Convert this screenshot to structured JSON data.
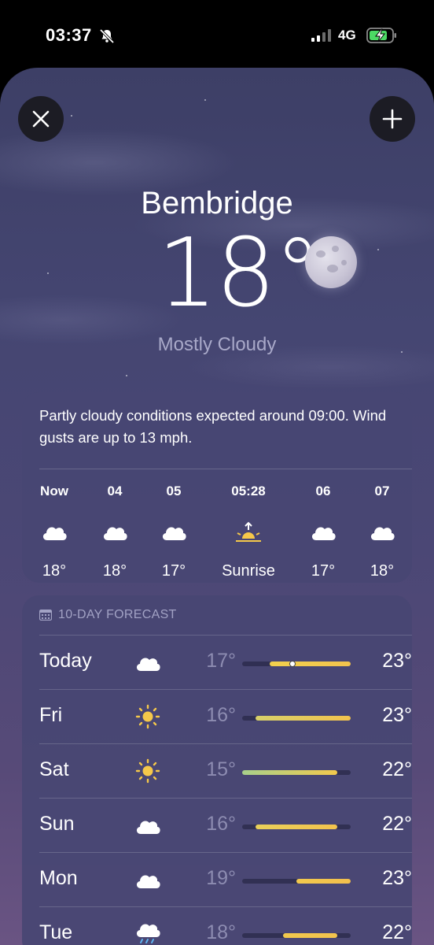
{
  "status_bar": {
    "time": "03:37",
    "network": "4G"
  },
  "header": {
    "city": "Bembridge",
    "temperature": "18°",
    "condition": "Mostly Cloudy"
  },
  "hourly": {
    "summary": "Partly cloudy conditions expected around 09:00. Wind gusts are up to 13 mph.",
    "items": [
      {
        "time": "Now",
        "icon": "cloud-icon",
        "temp": "18°"
      },
      {
        "time": "04",
        "icon": "cloud-icon",
        "temp": "18°"
      },
      {
        "time": "05",
        "icon": "cloud-icon",
        "temp": "17°"
      },
      {
        "time": "05:28",
        "icon": "sunrise-icon",
        "temp": "Sunrise"
      },
      {
        "time": "06",
        "icon": "cloud-icon",
        "temp": "17°"
      },
      {
        "time": "07",
        "icon": "cloud-icon",
        "temp": "18°"
      }
    ]
  },
  "forecast": {
    "header": "10-DAY FORECAST",
    "range": {
      "min": 15,
      "max": 23
    },
    "days": [
      {
        "day": "Today",
        "icon": "cloud-icon",
        "low": "17°",
        "high": "23°",
        "low_value": 17,
        "high_value": 23,
        "current_value": 18,
        "colors": [
          "#f2d14d",
          "#f2c34d"
        ]
      },
      {
        "day": "Fri",
        "icon": "sun-icon",
        "low": "16°",
        "high": "23°",
        "low_value": 16,
        "high_value": 23,
        "colors": [
          "#d7d06a",
          "#f2c34d"
        ]
      },
      {
        "day": "Sat",
        "icon": "sun-icon",
        "low": "15°",
        "high": "22°",
        "low_value": 15,
        "high_value": 22,
        "colors": [
          "#a8d08b",
          "#f2c94d"
        ]
      },
      {
        "day": "Sun",
        "icon": "cloud-icon",
        "low": "16°",
        "high": "22°",
        "low_value": 16,
        "high_value": 22,
        "colors": [
          "#e9d05a",
          "#f2c34d"
        ]
      },
      {
        "day": "Mon",
        "icon": "cloud-icon",
        "low": "19°",
        "high": "23°",
        "low_value": 19,
        "high_value": 23,
        "colors": [
          "#f2c94d",
          "#f2bf4d"
        ]
      },
      {
        "day": "Tue",
        "icon": "rain-cloud-icon",
        "low": "18°",
        "high": "22°",
        "low_value": 18,
        "high_value": 22,
        "colors": [
          "#f2c94d",
          "#f2c34d"
        ]
      }
    ]
  }
}
